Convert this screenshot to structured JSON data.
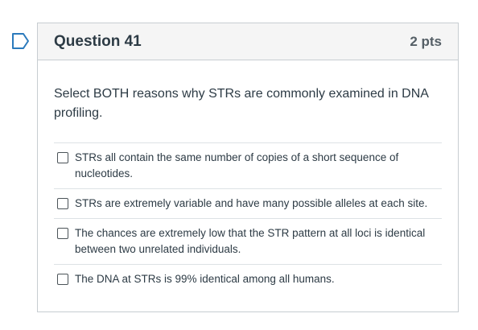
{
  "question": {
    "title": "Question 41",
    "points": "2 pts",
    "prompt": "Select BOTH reasons why STRs are commonly examined in DNA profiling.",
    "answers": [
      {
        "label": "STRs all contain the same number of copies of a short sequence of nucleotides."
      },
      {
        "label": "STRs are extremely variable and have many possible alleles at each site."
      },
      {
        "label": "The chances are extremely low that the STR pattern at all loci is identical between two unrelated individuals."
      },
      {
        "label": "The DNA at STRs is 99% identical among all humans."
      }
    ]
  },
  "colors": {
    "flag": "#2b7abc",
    "header_bg": "#f5f5f5",
    "border": "#c7cdd1",
    "text": "#2d3b45"
  },
  "icons": {
    "flag": "flag-bookmark-icon",
    "checkbox": "checkbox-unchecked-icon"
  }
}
